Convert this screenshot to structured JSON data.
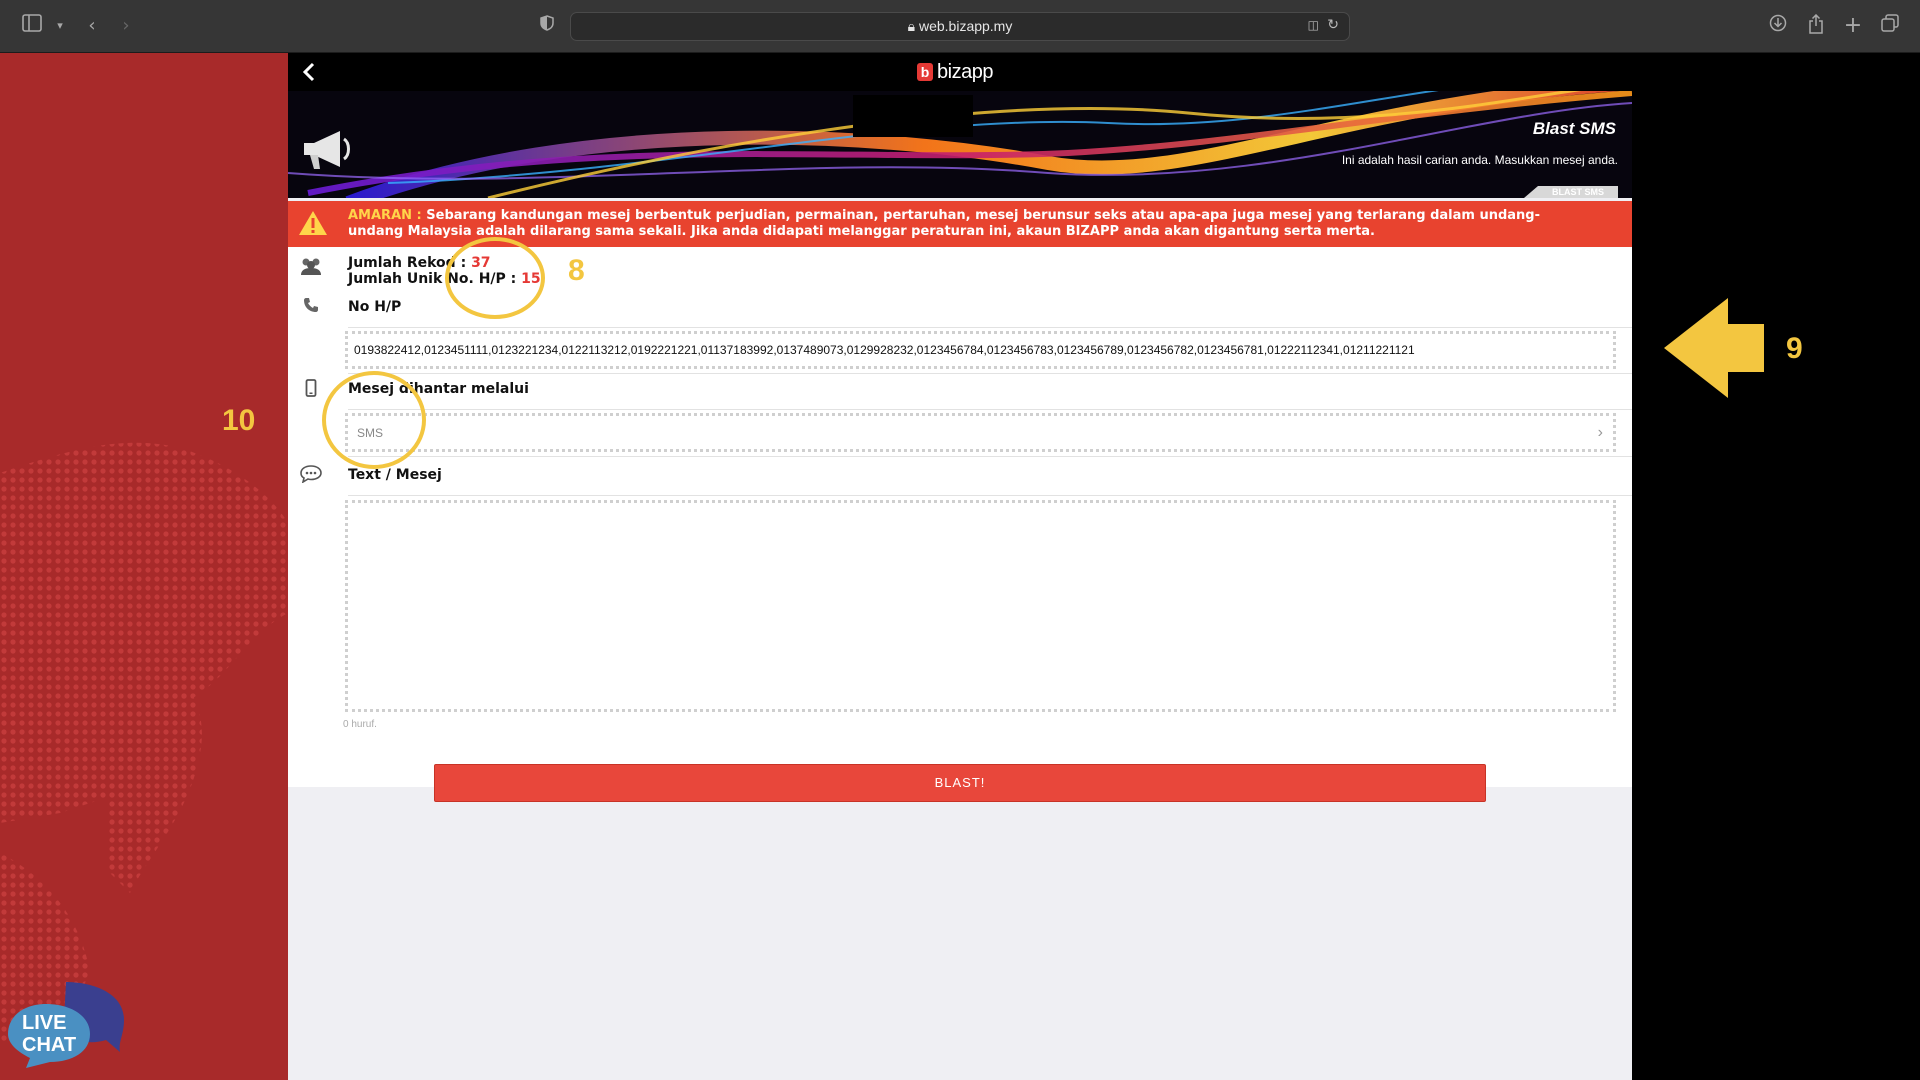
{
  "browser": {
    "url": "web.bizapp.my"
  },
  "header": {
    "logo_text": "bizapp",
    "title": "Blast SMS",
    "subtitle": "Ini adalah hasil carian anda. Masukkan mesej anda.",
    "tag": "BLAST SMS"
  },
  "warning": {
    "label": "AMARAN :",
    "text": "Sebarang kandungan mesej berbentuk perjudian, permainan, pertaruhan, mesej berunsur seks atau apa-apa juga mesej yang terlarang dalam undang-undang Malaysia adalah dilarang sama sekali. Jika anda didapati melanggar peraturan ini, akaun BIZAPP anda akan digantung serta merta."
  },
  "stats": {
    "records_label": "Jumlah Rekod :",
    "records_value": "37",
    "unique_label": "Jumlah Unik No. H/P :",
    "unique_value": "15"
  },
  "phone": {
    "label": "No H/P",
    "value": "0193822412,0123451111,0123221234,0122113212,0192221221,01137183992,0137489073,0129928232,0123456784,0123456783,0123456789,0123456782,0123456781,01222112341,01211221121"
  },
  "channel": {
    "label": "Mesej dihantar melalui",
    "value": "SMS"
  },
  "message": {
    "label": "Text / Mesej",
    "value": "",
    "counter": "0 huruf."
  },
  "actions": {
    "blast_label": "BLAST!"
  },
  "annotations": {
    "n8": "8",
    "n9": "9",
    "n10": "10",
    "color": "#f3c640"
  },
  "livechat": {
    "line1": "LIVE",
    "line2": "CHAT"
  },
  "colors": {
    "accent_red": "#e8432f",
    "sidebar_red": "#a82a2a",
    "warning_label": "#ffd54a"
  }
}
